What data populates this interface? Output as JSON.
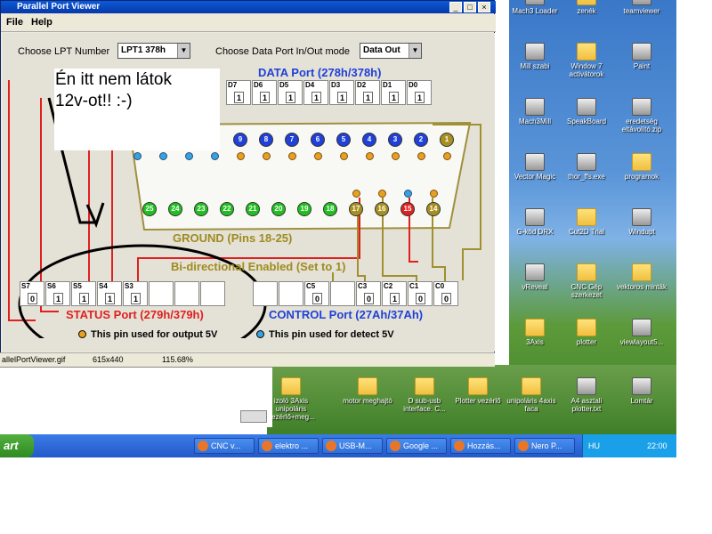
{
  "window": {
    "title": "Parallel Port Viewer",
    "menu": [
      "File",
      "Help"
    ]
  },
  "controls": {
    "lpt_label": "Choose LPT Number",
    "lpt_value": "LPT1  378h",
    "mode_label": "Choose Data Port In/Out mode",
    "mode_value": "Data Out"
  },
  "data_port": {
    "title": "DATA Port  (278h/378h)",
    "bits": [
      {
        "name": "D7",
        "value": "1"
      },
      {
        "name": "D6",
        "value": "1"
      },
      {
        "name": "D5",
        "value": "1"
      },
      {
        "name": "D4",
        "value": "1"
      },
      {
        "name": "D3",
        "value": "1"
      },
      {
        "name": "D2",
        "value": "1"
      },
      {
        "name": "D1",
        "value": "1"
      },
      {
        "name": "D0",
        "value": "1"
      }
    ]
  },
  "connector": {
    "top_pins": [
      "9",
      "8",
      "7",
      "6",
      "5",
      "4",
      "3",
      "2",
      "1"
    ],
    "ground_pins": [
      "25",
      "24",
      "23",
      "22",
      "21",
      "20",
      "19",
      "18"
    ],
    "right_bottom_pins": [
      "17",
      "16",
      "15",
      "14"
    ],
    "ground_label": "GROUND (Pins 18-25)",
    "bidir_label": "Bi-directional Enabled (Set to 1)"
  },
  "status_port": {
    "title": "STATUS Port  (279h/379h)",
    "bits": [
      {
        "name": "S7",
        "value": "0"
      },
      {
        "name": "S6",
        "value": "1"
      },
      {
        "name": "S5",
        "value": "1"
      },
      {
        "name": "S4",
        "value": "1"
      },
      {
        "name": "S3",
        "value": "1"
      },
      {
        "name": "",
        "value": ""
      },
      {
        "name": "",
        "value": ""
      },
      {
        "name": "",
        "value": ""
      }
    ]
  },
  "control_port": {
    "title": "CONTROL Port  (27Ah/37Ah)",
    "bits": [
      {
        "name": "",
        "value": ""
      },
      {
        "name": "",
        "value": ""
      },
      {
        "name": "C5",
        "value": "0"
      },
      {
        "name": "",
        "value": ""
      },
      {
        "name": "C3",
        "value": "0"
      },
      {
        "name": "C2",
        "value": "1"
      },
      {
        "name": "C1",
        "value": "0"
      },
      {
        "name": "C0",
        "value": "0"
      }
    ]
  },
  "legend": {
    "output": "This pin used for output 5V",
    "detect": "This pin used for detect 5V"
  },
  "statusbar": {
    "file": "allelPortViewer.gif",
    "size": "615x440",
    "zoom": "115.68%"
  },
  "note": {
    "line1": "Én itt nem látok",
    "line2": "12v-ot!!    :-)"
  },
  "desktop_icons": [
    {
      "label": "Mach3 Loader"
    },
    {
      "label": "zenék"
    },
    {
      "label": "teamviewer"
    },
    {
      "label": "Mill szabi"
    },
    {
      "label": "Window 7 activátorok"
    },
    {
      "label": "Paint"
    },
    {
      "label": "Mach3Mill"
    },
    {
      "label": "SpeakBoard"
    },
    {
      "label": "eredetség eltávolító.zip"
    },
    {
      "label": "Vector Magic"
    },
    {
      "label": "thor_ffs.exe"
    },
    {
      "label": "programok"
    },
    {
      "label": "G-kód DRX"
    },
    {
      "label": "Cut2D Trial"
    },
    {
      "label": "Windupt"
    },
    {
      "label": "vReveal"
    },
    {
      "label": "CNC Gép szerkezet"
    },
    {
      "label": "vektoros minták"
    },
    {
      "label": "3Axis"
    },
    {
      "label": "plotter"
    },
    {
      "label": "viewlayout5..."
    }
  ],
  "desktop_row": [
    {
      "label": "izoló 3Axis unipoláris Vezérlő+meg..."
    },
    {
      "label": "motor meghajtó"
    },
    {
      "label": "D sub-usb interface.  C..."
    },
    {
      "label": "Plotter vezérlő"
    },
    {
      "label": "unipoláris 4axis faca"
    },
    {
      "label": "A4 asztali plotter.txt"
    },
    {
      "label": "Lomtár"
    }
  ],
  "taskbar": {
    "start": "art",
    "tasks": [
      "CNC v...",
      "elektro ...",
      "USB-M...",
      "Google ...",
      "Hozzás...",
      "Nero P..."
    ],
    "lang": "HU",
    "clock": "22:00"
  }
}
